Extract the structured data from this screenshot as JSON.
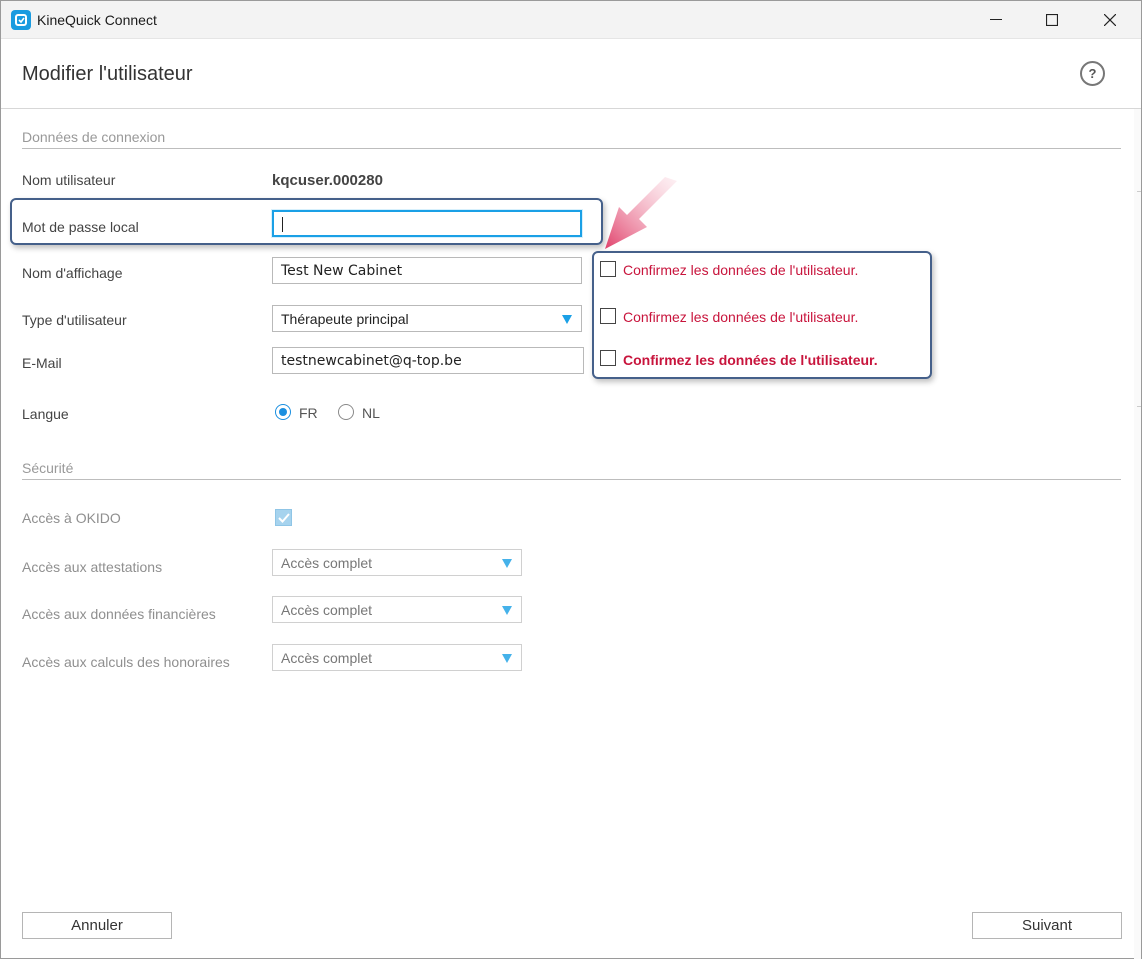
{
  "window": {
    "app_title": "KineQuick Connect",
    "minimize_glyph": "—",
    "maximize_glyph": "☐",
    "close_glyph": "✕"
  },
  "header": {
    "title": "Modifier l'utilisateur",
    "help_glyph": "?"
  },
  "connexion": {
    "section_title": "Données de connexion",
    "username_label": "Nom utilisateur",
    "username_value": "kqcuser.000280",
    "password_label": "Mot de passe local",
    "password_value": "",
    "display_name_label": "Nom d'affichage",
    "display_name_value": "Test New Cabinet",
    "user_type_label": "Type d'utilisateur",
    "user_type_value": "Thérapeute principal",
    "email_label": "E-Mail",
    "email_value": "testnewcabinet@q-top.be",
    "language_label": "Langue",
    "language_options": [
      "FR",
      "NL"
    ],
    "language_selected": "FR"
  },
  "confirm": {
    "items": [
      {
        "text": "Confirmez les données de l'utilisateur.",
        "bold": false,
        "checked": false
      },
      {
        "text": "Confirmez les données de l'utilisateur.",
        "bold": false,
        "checked": false
      },
      {
        "text": "Confirmez les données de l'utilisateur.",
        "bold": true,
        "checked": false
      }
    ],
    "text_color": "#c8143c"
  },
  "securite": {
    "section_title": "Sécurité",
    "okido_label": "Accès à OKIDO",
    "okido_checked": true,
    "attestations_label": "Accès aux attestations",
    "attestations_value": "Accès complet",
    "financial_label": "Accès aux données financières",
    "financial_value": "Accès complet",
    "fees_label": "Accès aux calculs des honoraires",
    "fees_value": "Accès complet"
  },
  "footer": {
    "cancel_label": "Annuler",
    "next_label": "Suivant"
  },
  "colors": {
    "accent": "#1aa0e6",
    "annotation_border": "#45608a",
    "annotation_arrow": "#e0406a"
  }
}
